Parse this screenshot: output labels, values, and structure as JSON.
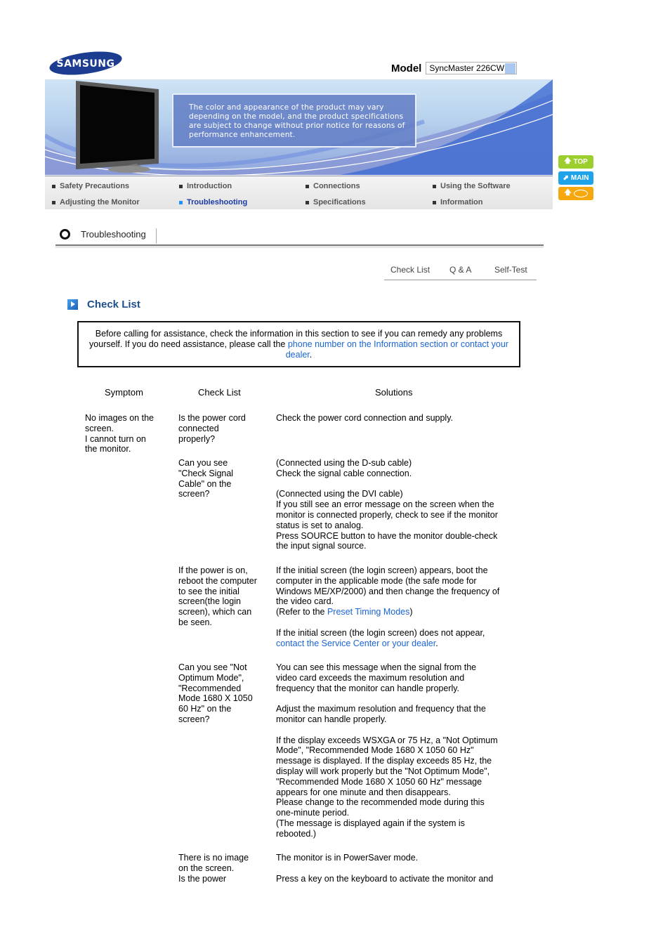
{
  "header": {
    "brand": "SAMSUNG",
    "model_label": "Model",
    "model_value": "SyncMaster 226CW"
  },
  "banner": {
    "notice": "The color and appearance of the product may vary depending on the model, and the product specifications are subject to change without prior notice for reasons of performance enhancement."
  },
  "nav": {
    "items": [
      {
        "label": "Safety Precautions",
        "active": false
      },
      {
        "label": "Introduction",
        "active": false
      },
      {
        "label": "Connections",
        "active": false
      },
      {
        "label": "Using the Software",
        "active": false
      },
      {
        "label": "Adjusting the Monitor",
        "active": false
      },
      {
        "label": "Troubleshooting",
        "active": true
      },
      {
        "label": "Specifications",
        "active": false
      },
      {
        "label": "Information",
        "active": false
      }
    ]
  },
  "side_buttons": {
    "top": "TOP",
    "main": "MAIN",
    "lang": ""
  },
  "colors": {
    "link": "#1a64d6",
    "heading": "#1e4f8c",
    "nav_active": "#1b3aa5",
    "top_btn": "#9ccf2e",
    "main_btn": "#1ea3e8",
    "lang_btn": "#f7a80e"
  },
  "section": {
    "title": "Troubleshooting",
    "subtabs": [
      "Check List",
      "Q & A",
      "Self-Test"
    ]
  },
  "content": {
    "heading": "Check List",
    "intro_text": "Before calling for assistance, check the information in this section to see if you can remedy any problems yourself. If you do need assistance, please call the ",
    "intro_link": "phone number on the Information section or contact your dealer",
    "intro_end": ".",
    "columns": [
      "Symptom",
      "Check List",
      "Solutions"
    ],
    "symptom1": [
      "No images on the",
      "screen.",
      "I cannot turn on",
      "the monitor."
    ],
    "rows": [
      {
        "check": [
          "Is the power cord",
          "connected",
          "properly?"
        ],
        "solution": [
          "Check the power cord connection and supply."
        ]
      },
      {
        "check": [
          "Can you see",
          "\"Check Signal",
          "Cable\" on the",
          "screen?"
        ],
        "solution": [
          "(Connected using the D-sub cable)",
          "Check the signal cable connection.",
          "",
          "(Connected using the DVI cable)",
          "If you still see an error message on the screen when the",
          "monitor is connected properly, check to see if the monitor",
          "status is set to analog.",
          "Press SOURCE button to have the monitor double-check",
          "the input signal source."
        ]
      },
      {
        "check": [
          "If the power is on,",
          "reboot the computer",
          "to see the initial",
          "screen(the login",
          "screen), which can",
          "be seen."
        ],
        "solution": [
          "If the initial screen (the login screen) appears, boot the",
          "computer in the applicable mode (the safe mode for",
          "Windows ME/XP/2000) and then change the frequency of",
          "the video card."
        ],
        "refer_pre": "(Refer to the ",
        "refer_link": "Preset Timing Modes",
        "refer_post": ")",
        "solution2": "If the initial screen (the login screen) does not appear,",
        "service_link": "contact the Service Center or your dealer",
        "service_post": "."
      },
      {
        "check": [
          "Can you see \"Not",
          "Optimum Mode\",",
          "\"Recommended",
          "Mode 1680 X 1050",
          "60 Hz\" on the",
          "screen?"
        ],
        "solution": [
          "You can see this message when the signal from the",
          "video card exceeds the maximum resolution and",
          "frequency that the monitor can handle properly.",
          "",
          "Adjust the maximum resolution and frequency that the",
          "monitor can handle properly.",
          "",
          "If the display exceeds WSXGA or 75 Hz, a \"Not Optimum",
          "Mode\", \"Recommended Mode 1680 X 1050 60 Hz\"",
          "message is displayed. If the display exceeds 85 Hz, the",
          "display will work properly but the \"Not Optimum Mode\",",
          "\"Recommended Mode 1680 X 1050 60 Hz\" message",
          "appears for one minute and then disappears.",
          "Please change to the recommended mode during this",
          "one-minute period.",
          "(The message is displayed again if the system is",
          "rebooted.)"
        ]
      },
      {
        "check": [
          "There is no image",
          "on the screen.",
          "Is the power"
        ],
        "solution": [
          "The monitor is in PowerSaver mode.",
          "",
          "Press a key on the keyboard to activate the monitor and"
        ]
      }
    ]
  }
}
